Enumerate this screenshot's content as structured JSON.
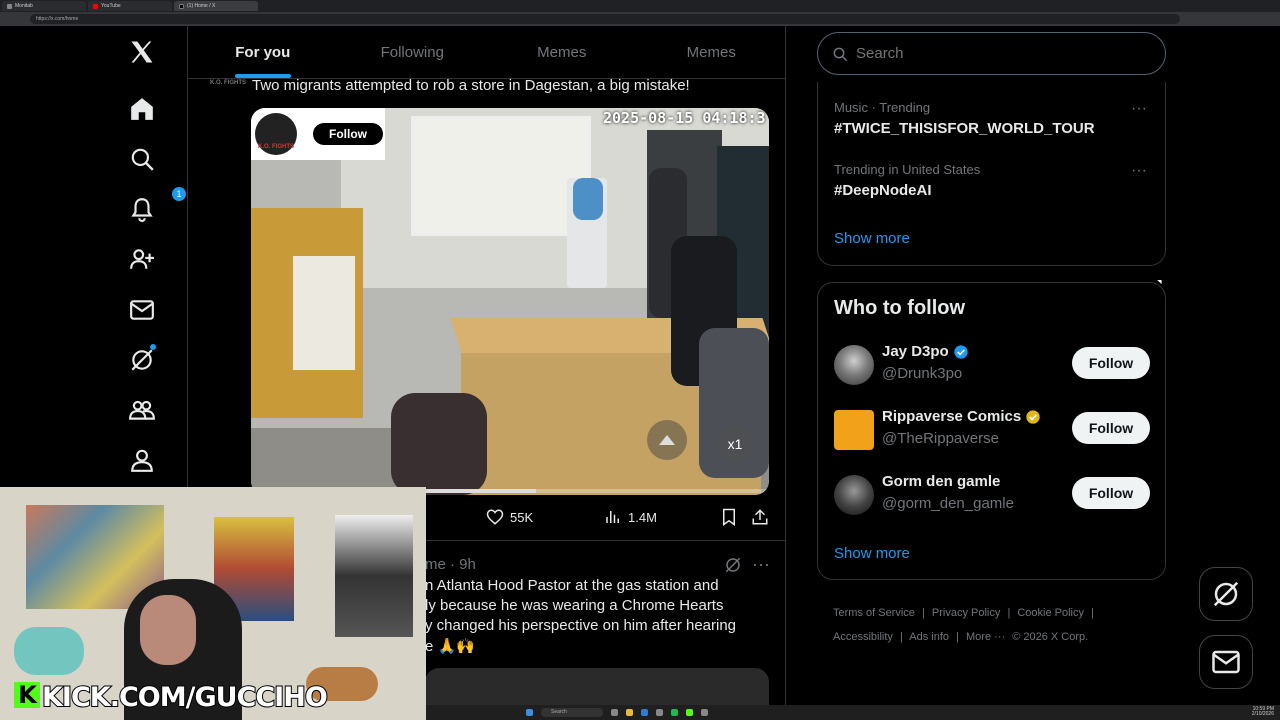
{
  "browser": {
    "tabs": [
      {
        "label": "Monitab"
      },
      {
        "label": "YouTube"
      },
      {
        "label": "(1) Home / X"
      }
    ],
    "url": "https://x.com/home"
  },
  "nav": {
    "items": [
      "x-logo",
      "home",
      "explore",
      "notifications",
      "follow",
      "messages",
      "grok",
      "communities",
      "profile"
    ],
    "notification_count": "1"
  },
  "feed": {
    "tabs": [
      {
        "label": "For you",
        "active": true
      },
      {
        "label": "Following",
        "active": false
      },
      {
        "label": "Memes",
        "active": false
      },
      {
        "label": "Memes",
        "active": false
      }
    ],
    "post1": {
      "author_tag": "K.O. FIGHTS",
      "text": "Two migrants attempted to rob a store in Dagestan, a big mistake!",
      "video": {
        "timestamp": "2025-08-15 04:18:3",
        "overlay_follow": "Follow",
        "overlay_logo": "K.O. FIGHTS",
        "speed": "x1",
        "progress": 0.55
      },
      "likes": "55K",
      "views": "1.4M"
    },
    "post2": {
      "meta": "me · 9h",
      "lines": [
        "n Atlanta Hood Pastor at the gas station and",
        "ly because he was wearing a Chrome Hearts",
        "y changed his perspective on him after hearing",
        "e 🙏🙌"
      ]
    }
  },
  "sidebar": {
    "search_placeholder": "Search",
    "trends": [
      {
        "category": "Music · Trending",
        "name": "#TWICE_THISISFOR_WORLD_TOUR"
      },
      {
        "category": "Trending in United States",
        "name": "#DeepNodeAI"
      }
    ],
    "trends_show_more": "Show more",
    "who_to_follow": {
      "title": "Who to follow",
      "users": [
        {
          "name": "Jay D3po",
          "handle": "@Drunk3po",
          "badge": "blue",
          "follow": "Follow"
        },
        {
          "name": "Rippaverse Comics",
          "handle": "@TheRippaverse",
          "badge": "gold",
          "follow": "Follow"
        },
        {
          "name": "Gorm den gamle",
          "handle": "@gorm_den_gamle",
          "badge": "",
          "follow": "Follow"
        }
      ],
      "show_more": "Show more"
    },
    "footer": {
      "links": [
        "Terms of Service",
        "|",
        "Privacy Policy",
        "|",
        "Cookie Policy",
        "|",
        "Accessibility",
        "|",
        "Ads info",
        "|",
        "More ···",
        "© 2026 X Corp."
      ]
    }
  },
  "webcam": {
    "banner": "KICK.COM/GUCCIHO",
    "k_logo": "K"
  },
  "taskbar": {
    "search_label": "Search",
    "time": "10:59 PM",
    "date": "2/10/2026"
  },
  "colors": {
    "accent": "#1d9bf0",
    "background": "#000000",
    "border": "#2f3336",
    "muted": "#71767b",
    "kick_green": "#53fc18"
  }
}
